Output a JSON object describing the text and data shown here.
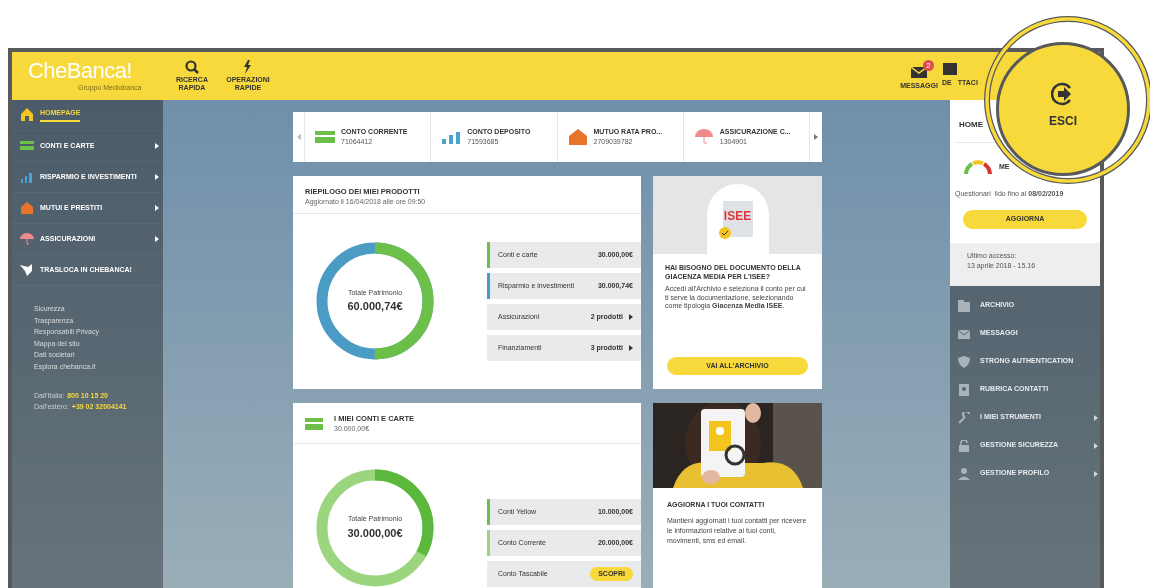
{
  "header": {
    "logo": "CheBanca!",
    "logo_subtitle": "Gruppo Mediobanca",
    "left_actions": [
      {
        "label": "RICERCA\nRAPIDA"
      },
      {
        "label": "OPERAZIONI\nRAPIDE"
      }
    ],
    "right_actions": [
      {
        "label": "MESSAGGI",
        "badge": "2"
      },
      {
        "label": "DE",
        "label_tail": "TTACI"
      }
    ]
  },
  "sidebar": {
    "items": [
      {
        "label": "HOMEPAGE",
        "selected": true,
        "submenu": false
      },
      {
        "label": "CONTI E CARTE",
        "selected": false,
        "submenu": true
      },
      {
        "label": "RISPARMIO E INVESTIMENTI",
        "selected": false,
        "submenu": true
      },
      {
        "label": "MUTUI E PRESTITI",
        "selected": false,
        "submenu": true
      },
      {
        "label": "ASSICURAZIONI",
        "selected": false,
        "submenu": true
      },
      {
        "label": "TRASLOCA IN CHEBANCA!",
        "selected": false,
        "submenu": false
      }
    ],
    "links": [
      "Sicurezza",
      "Trasparenza",
      "Responsabili Privacy",
      "Mappa del sito",
      "Dati societari",
      "Esplora chebanca.it"
    ],
    "contacts": [
      {
        "label": "Dall'Italia:",
        "value": "800 10 15 20"
      },
      {
        "label": "Dall'estero:",
        "value": "+39 02 32004141"
      }
    ]
  },
  "products": [
    {
      "title": "CONTO CORRENTE",
      "number": "71064412"
    },
    {
      "title": "CONTO DEPOSITO",
      "number": "71593685"
    },
    {
      "title": "MUTUO RATA PRO...",
      "number": "2709039782"
    },
    {
      "title": "ASSICURAZIONE C...",
      "number": "1304901"
    }
  ],
  "summary_card": {
    "title": "RIEPILOGO DEI MIEI PRODOTTI",
    "subtitle": "Aggiornato il 16/04/2018 alle ore 09:50",
    "donut_label": "Totale Patrimonio",
    "donut_value": "60.000,74€",
    "rows": [
      {
        "kind": "amount",
        "label": "Conti e carte",
        "value": "30.000,00€",
        "color": "#6cc04a"
      },
      {
        "kind": "amount",
        "label": "Risparmio e investimenti",
        "value": "30.000,74€",
        "color": "#4a9cc4"
      },
      {
        "kind": "count",
        "label": "Assicurazioni",
        "value": "2 prodotti"
      },
      {
        "kind": "count",
        "label": "Finanziamenti",
        "value": "3 prodotti"
      }
    ]
  },
  "isee_card": {
    "badge_text": "ISEE",
    "title": "HAI BISOGNO DEL DOCUMENTO DELLA GIACENZA MEDIA PER L'ISEE?",
    "body": "Accedi all'Archivio e seleziona il conto per cui ti serve la documentazione, selezionando come tipologia **Giacenza Media ISEE**.",
    "button": "VAI ALL'ARCHIVIO"
  },
  "accounts_card": {
    "title": "I MIEI CONTI E CARTE",
    "subtitle": "30.000,00€",
    "donut_label": "Totale Patrimonio",
    "donut_value": "30.000,00€",
    "rows": [
      {
        "kind": "amount",
        "label": "Conti Yellow",
        "value": "10.000,00€",
        "color": "#6cc04a"
      },
      {
        "kind": "amount",
        "label": "Conto Corrente",
        "value": "20.000,00€",
        "color": "#9bd67f"
      },
      {
        "kind": "action",
        "label": "Conto Tascabile",
        "value": "SCOPRI"
      }
    ]
  },
  "contacts_card": {
    "title": "AGGIORNA I TUOI CONTATTI",
    "body": "Mantieni aggiornati i tuoi contatti per ricevere le informazioni relative ai tuoi conti, movimenti, sms ed email."
  },
  "right_panel": {
    "title": "HOME",
    "meter_label": "ME",
    "questionnaire": "Questionari",
    "validity": "lido fino al **08/02/2019**",
    "button": "AGGIORNA",
    "last_access_label": "Ultimo accesso:",
    "last_access": "13 aprile 2018 - 15.16",
    "items": [
      {
        "label": "ARCHIVIO",
        "submenu": false
      },
      {
        "label": "MESSAGGI",
        "submenu": false
      },
      {
        "label": "STRONG AUTHENTICATION",
        "submenu": false
      },
      {
        "label": "RUBRICA CONTATTI",
        "submenu": false
      },
      {
        "label": "I MIEI STRUMENTI",
        "submenu": true
      },
      {
        "label": "GESTIONE SICUREZZA",
        "submenu": true
      },
      {
        "label": "GESTIONE PROFILO",
        "submenu": true
      }
    ]
  },
  "callout": {
    "label": "ESCI"
  }
}
